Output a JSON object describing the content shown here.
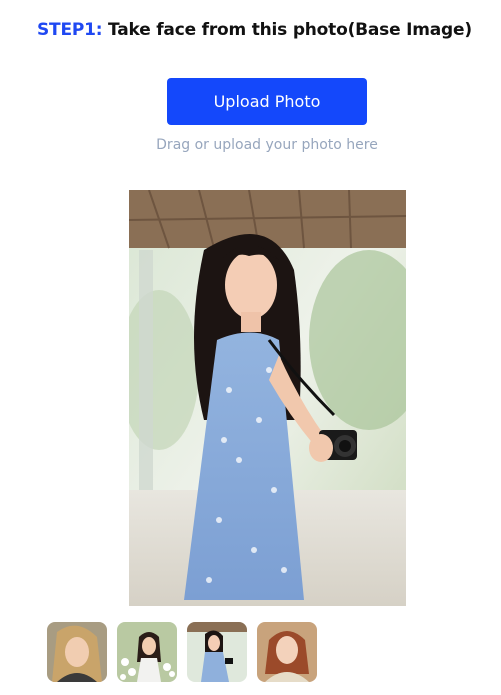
{
  "step": {
    "label": "STEP1:",
    "text": " Take face from this photo(Base Image)"
  },
  "upload": {
    "button_label": "Upload Photo",
    "hint": "Drag or upload your photo here"
  },
  "colors": {
    "accent": "#1448fb",
    "step_label": "#1f48f2",
    "hint_text": "#97a6bd"
  },
  "thumbnails": [
    {
      "icon": "blonde-woman-portrait"
    },
    {
      "icon": "woman-in-flower-field"
    },
    {
      "icon": "woman-with-camera"
    },
    {
      "icon": "redhead-woman-portrait"
    }
  ]
}
